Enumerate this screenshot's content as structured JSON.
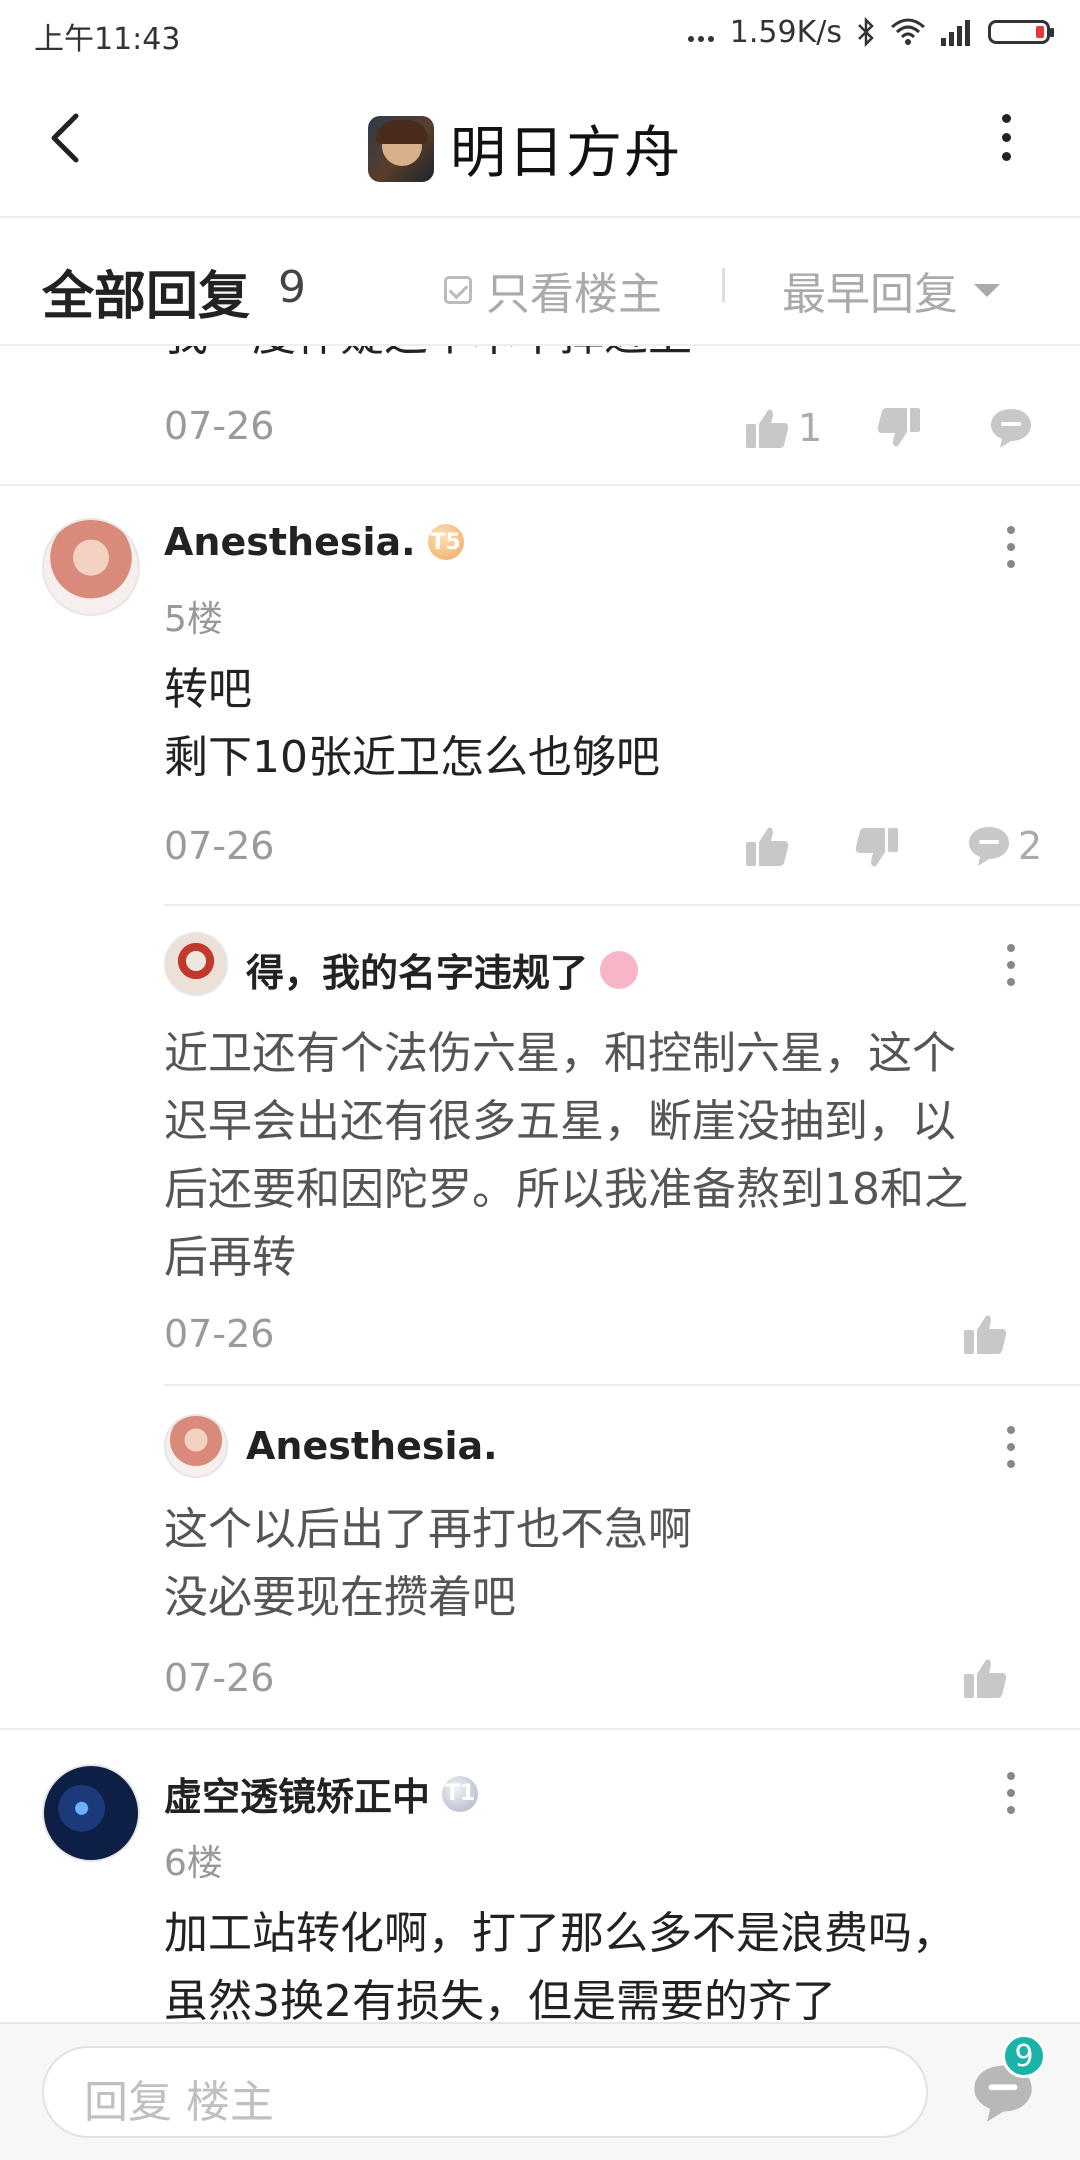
{
  "status": {
    "time": "上午11:43",
    "net_speed": "1.59K/s"
  },
  "nav": {
    "title": "明日方舟"
  },
  "filter": {
    "all_replies": "全部回复",
    "count": "9",
    "only_host": "只看楼主",
    "sort": "最早回复"
  },
  "prev_post": {
    "partial_text": "我一度怀疑这个本不掉近卫",
    "date": "07-26",
    "likes": "1"
  },
  "post5": {
    "user": "Anesthesia.",
    "badge": "T5",
    "floor": "5楼",
    "lines": [
      "转吧",
      "剩下10张近卫怎么也够吧"
    ],
    "date": "07-26",
    "comments": "2"
  },
  "reply1": {
    "user": "得，我的名字违规了",
    "lines": [
      "近卫还有个法伤六星，和控制六星，这个",
      "迟早会出还有很多五星，断崖没抽到，以",
      "后还要和因陀罗。所以我准备熬到18和之",
      "后再转"
    ],
    "date": "07-26"
  },
  "reply2": {
    "user": "Anesthesia.",
    "lines": [
      "这个以后出了再打也不急啊",
      "没必要现在攒着吧"
    ],
    "date": "07-26"
  },
  "post6": {
    "user": "虚空透镜矫正中",
    "badge": "T1",
    "floor": "6楼",
    "lines": [
      "加工站转化啊，打了那么多不是浪费吗，",
      "虽然3换2有损失，但是需要的齐了"
    ]
  },
  "bottom": {
    "reply_placeholder": "回复 楼主",
    "comment_count": "9"
  },
  "colors": {
    "accent": "#19b3a8",
    "battery_low": "#e53935"
  }
}
